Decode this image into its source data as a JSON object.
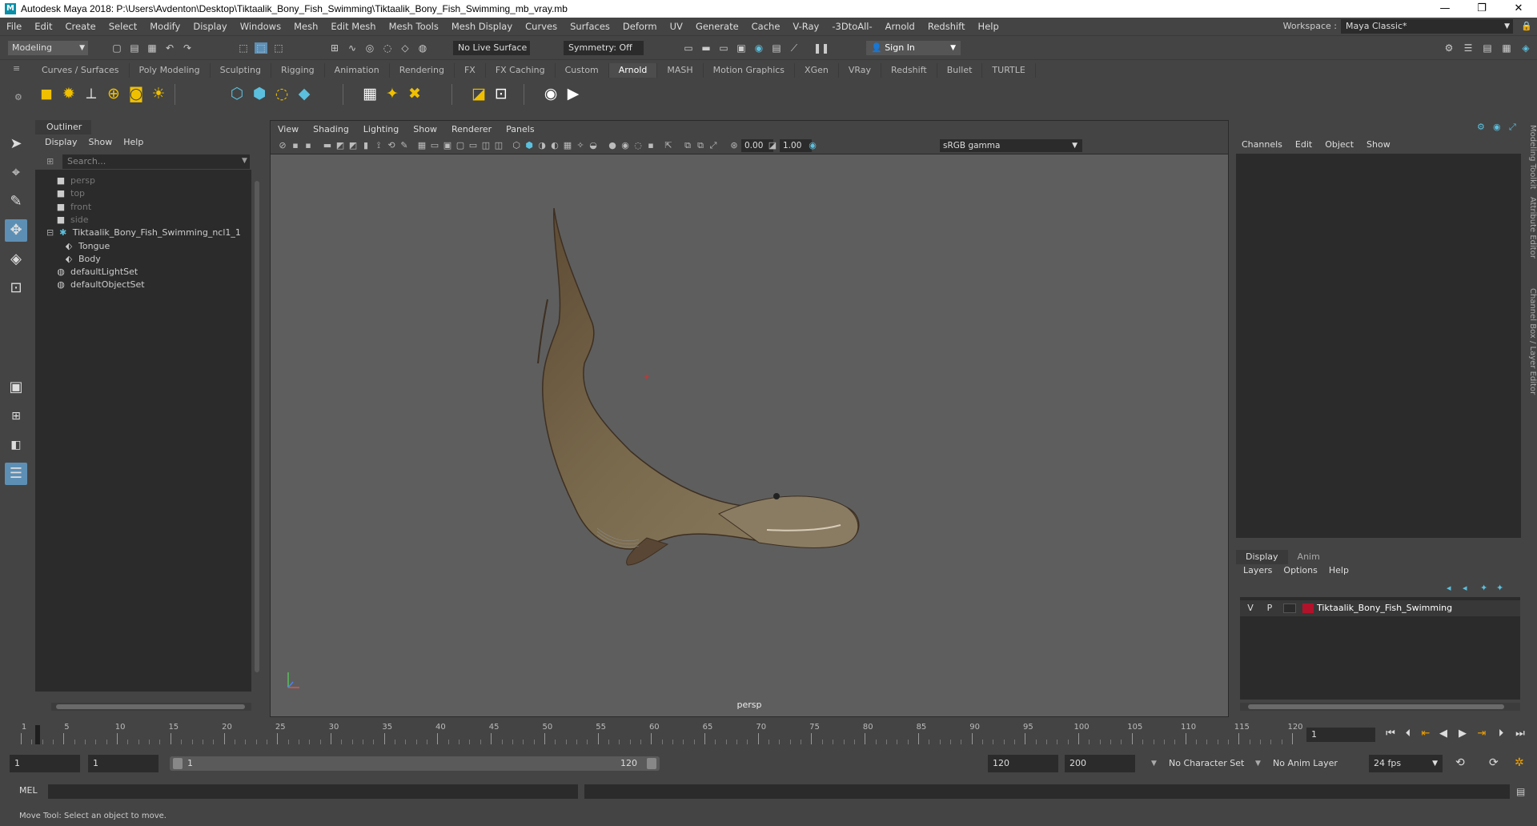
{
  "window": {
    "title": "Autodesk Maya 2018: P:\\Users\\Avdenton\\Desktop\\Tiktaalik_Bony_Fish_Swimming\\Tiktaalik_Bony_Fish_Swimming_mb_vray.mb",
    "app_icon_letter": "M",
    "minimize": "—",
    "maximize": "❐",
    "close": "✕"
  },
  "menubar": {
    "items": [
      "File",
      "Edit",
      "Create",
      "Select",
      "Modify",
      "Display",
      "Windows",
      "Mesh",
      "Edit Mesh",
      "Mesh Tools",
      "Mesh Display",
      "Curves",
      "Surfaces",
      "Deform",
      "UV",
      "Generate",
      "Cache",
      "V-Ray",
      "-3DtoAll-",
      "Arnold",
      "Redshift",
      "Help"
    ],
    "workspace_label": "Workspace :",
    "workspace_value": "Maya Classic*"
  },
  "statusline": {
    "mode": "Modeling",
    "live_surface": "No Live Surface",
    "symmetry": "Symmetry: Off",
    "sign_in": "Sign In"
  },
  "shelf": {
    "tabs": [
      "Curves / Surfaces",
      "Poly Modeling",
      "Sculpting",
      "Rigging",
      "Animation",
      "Rendering",
      "FX",
      "FX Caching",
      "Custom",
      "Arnold",
      "MASH",
      "Motion Graphics",
      "XGen",
      "VRay",
      "Redshift",
      "Bullet",
      "TURTLE"
    ],
    "active_tab": "Arnold"
  },
  "outliner": {
    "tab": "Outliner",
    "menu": [
      "Display",
      "Show",
      "Help"
    ],
    "search_placeholder": "Search...",
    "items": [
      {
        "label": "persp",
        "dim": true,
        "icon": "camera-icon"
      },
      {
        "label": "top",
        "dim": true,
        "icon": "camera-icon"
      },
      {
        "label": "front",
        "dim": true,
        "icon": "camera-icon"
      },
      {
        "label": "side",
        "dim": true,
        "icon": "camera-icon"
      },
      {
        "label": "Tiktaalik_Bony_Fish_Swimming_ncl1_1",
        "dim": false,
        "icon": "joint-icon"
      },
      {
        "label": "Tongue",
        "dim": false,
        "icon": "mesh-icon"
      },
      {
        "label": "Body",
        "dim": false,
        "icon": "mesh-icon"
      },
      {
        "label": "defaultLightSet",
        "dim": false,
        "icon": "set-icon"
      },
      {
        "label": "defaultObjectSet",
        "dim": false,
        "icon": "set-icon"
      }
    ]
  },
  "viewport": {
    "menu": [
      "View",
      "Shading",
      "Lighting",
      "Show",
      "Renderer",
      "Panels"
    ],
    "exposure": "0.00",
    "gamma": "1.00",
    "color_space": "sRGB gamma",
    "camera_label": "persp"
  },
  "channelbox": {
    "menu": [
      "Channels",
      "Edit",
      "Object",
      "Show"
    ],
    "layer_tabs": [
      "Display",
      "Anim"
    ],
    "layer_menu": [
      "Layers",
      "Options",
      "Help"
    ],
    "layer": {
      "v": "V",
      "p": "P",
      "name": "Tiktaalik_Bony_Fish_Swimming",
      "color": "#b3122b"
    },
    "side_tabs": [
      "Modeling Toolkit",
      "Attribute Editor",
      "Channel Box / Layer Editor"
    ]
  },
  "timeslider": {
    "labels": [
      "1",
      "5",
      "10",
      "15",
      "20",
      "25",
      "30",
      "35",
      "40",
      "45",
      "50",
      "55",
      "60",
      "65",
      "70",
      "75",
      "80",
      "85",
      "90",
      "95",
      "100",
      "105",
      "110",
      "115",
      "120"
    ],
    "current_frame": "1"
  },
  "rangeslider": {
    "start": "1",
    "playback_start": "1",
    "range_start_label": "1",
    "range_end_label": "120",
    "playback_end": "120",
    "end": "200",
    "character_set": "No Character Set",
    "anim_layer": "No Anim Layer",
    "fps": "24 fps"
  },
  "cmdline": {
    "label": "MEL"
  },
  "helpline": {
    "text": "Move Tool: Select an object to move."
  }
}
